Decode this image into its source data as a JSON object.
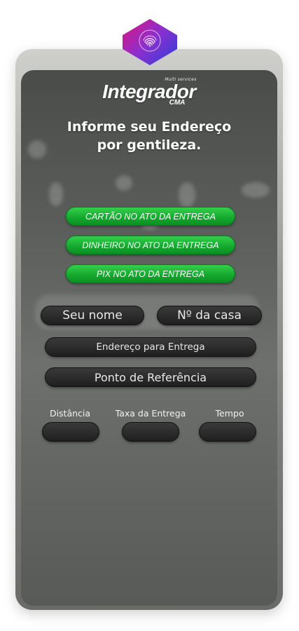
{
  "brand": {
    "small": "Multi services",
    "name": "Integrador",
    "sub": "CMA"
  },
  "headline": {
    "line1": "Informe seu Endereço",
    "line2": "por gentileza."
  },
  "payment_options": [
    {
      "label": "CARTÃO NO ATO DA ENTREGA"
    },
    {
      "label": "DINHEIRO NO ATO DA ENTREGA"
    },
    {
      "label": "PIX NO ATO DA ENTREGA"
    }
  ],
  "form": {
    "name_placeholder": "Seu nome",
    "house_number_placeholder": "Nº da casa",
    "address_placeholder": "Endereço para Entrega",
    "reference_placeholder": "Ponto de Referência"
  },
  "metrics": {
    "distance_label": "Distância",
    "fee_label": "Taxa da Entrega",
    "time_label": "Tempo"
  },
  "colors": {
    "accent_green": "#14a72e",
    "logo_gradient_start": "#e0157c",
    "logo_gradient_end": "#2b3fd8"
  },
  "icons": {
    "logo": "fingerprint-icon"
  }
}
